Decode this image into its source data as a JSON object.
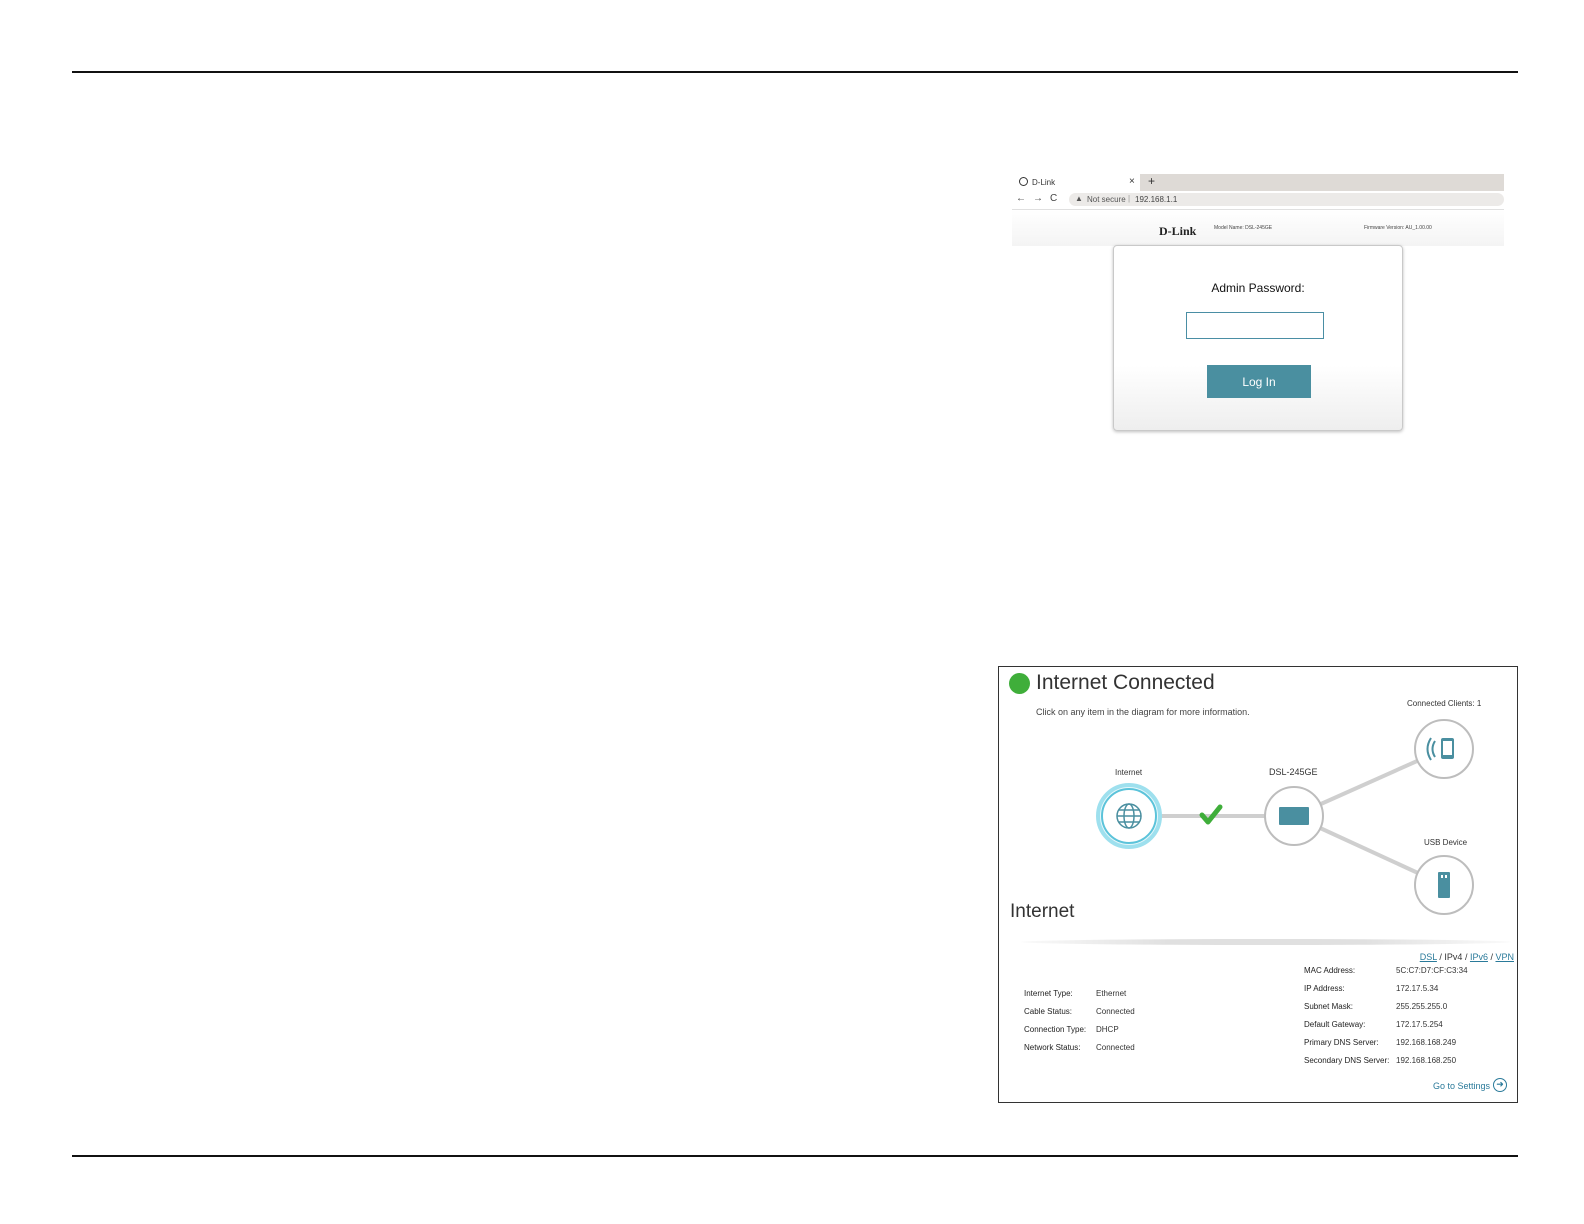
{
  "login": {
    "tab_title": "D-Link",
    "tab_close": "×",
    "new_tab": "+",
    "nav": {
      "back": "←",
      "forward": "→",
      "reload": "C"
    },
    "warning_icon": "▲",
    "not_secure": "Not secure",
    "url_separator": "|",
    "url": "192.168.1.1",
    "brand": "D-Link",
    "model_name": "Model Name: DSL-245GE",
    "firmware_version": "Firmware Version: AU_1.00.00",
    "password_label": "Admin Password:",
    "password_value": "",
    "login_button": "Log In"
  },
  "home": {
    "status_title": "Internet Connected",
    "status_color": "#3fae3a",
    "hint": "Click on any item in the diagram for more information.",
    "connected_clients_label": "Connected Clients:",
    "connected_clients_count": "1",
    "usb_label": "USB Device",
    "internet_label": "Internet",
    "router_label": "DSL-245GE",
    "section_title": "Internet",
    "connection_tabs": [
      {
        "label": "DSL",
        "link": true
      },
      {
        "label": "IPv4",
        "link": false
      },
      {
        "label": "IPv6",
        "link": true
      },
      {
        "label": "VPN",
        "link": true
      }
    ],
    "tab_separator": " / ",
    "left_info": [
      {
        "key": "Internet Type:",
        "value": "Ethernet"
      },
      {
        "key": "Cable Status:",
        "value": "Connected"
      },
      {
        "key": "Connection Type:",
        "value": "DHCP"
      },
      {
        "key": "Network Status:",
        "value": "Connected"
      }
    ],
    "right_info": [
      {
        "key": "MAC Address:",
        "value": "5C:C7:D7:CF:C3:34"
      },
      {
        "key": "IP Address:",
        "value": "172.17.5.34"
      },
      {
        "key": "Subnet Mask:",
        "value": "255.255.255.0"
      },
      {
        "key": "Default Gateway:",
        "value": "172.17.5.254"
      },
      {
        "key": "Primary DNS Server:",
        "value": "192.168.168.249"
      },
      {
        "key": "Secondary DNS Server:",
        "value": "192.168.168.250"
      }
    ],
    "settings_link": "Go to Settings",
    "settings_arrow": "➜",
    "accent_color": "#4a8fa0"
  }
}
